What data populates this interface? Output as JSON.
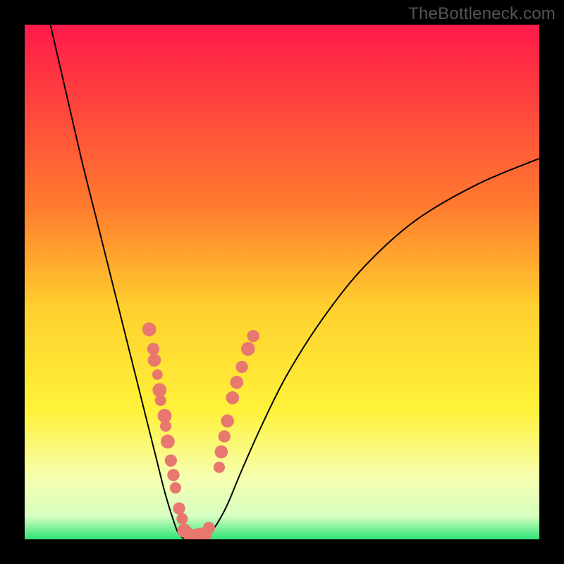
{
  "watermark": "TheBottleneck.com",
  "chart_data": {
    "type": "line",
    "title": "",
    "xlabel": "",
    "ylabel": "",
    "xlim": [
      0,
      100
    ],
    "ylim": [
      0,
      100
    ],
    "gradient_stops": [
      {
        "offset": 0.0,
        "color": "#ff1a4a"
      },
      {
        "offset": 0.35,
        "color": "#ff7a2e"
      },
      {
        "offset": 0.55,
        "color": "#ffd02e"
      },
      {
        "offset": 0.75,
        "color": "#fff23a"
      },
      {
        "offset": 0.88,
        "color": "#f6ffb0"
      },
      {
        "offset": 0.955,
        "color": "#d6ffc0"
      },
      {
        "offset": 1.0,
        "color": "#2ee37a"
      }
    ],
    "series": [
      {
        "name": "left-curve",
        "type": "curve",
        "x": [
          5,
          8,
          11,
          14,
          17,
          19,
          21,
          23,
          24.5,
          26,
          27,
          28,
          28.8,
          29.3,
          29.7,
          30.2,
          30.7,
          31.2
        ],
        "y": [
          100,
          87,
          74,
          62,
          50,
          42,
          34,
          26,
          20,
          14,
          10,
          6.5,
          4,
          2.5,
          1.5,
          0.8,
          0.3,
          0.1
        ]
      },
      {
        "name": "valley-floor",
        "type": "curve",
        "x": [
          31.2,
          32.0,
          33.0,
          34.0,
          35.0
        ],
        "y": [
          0.1,
          0.05,
          0.05,
          0.1,
          0.3
        ]
      },
      {
        "name": "right-curve",
        "type": "curve",
        "x": [
          35.0,
          36.0,
          37.5,
          39.5,
          42,
          46,
          51,
          58,
          66,
          76,
          88,
          100
        ],
        "y": [
          0.3,
          1.2,
          3.2,
          7,
          13,
          22,
          32,
          43,
          53,
          62,
          69,
          74
        ]
      }
    ],
    "scatter": {
      "name": "dots",
      "color": "#e8786f",
      "points": [
        {
          "x": 24.2,
          "y": 40.8,
          "r": 1.6
        },
        {
          "x": 25.0,
          "y": 37.0,
          "r": 1.4
        },
        {
          "x": 25.2,
          "y": 34.8,
          "r": 1.5
        },
        {
          "x": 25.8,
          "y": 32.0,
          "r": 1.2
        },
        {
          "x": 26.2,
          "y": 29.0,
          "r": 1.6
        },
        {
          "x": 26.4,
          "y": 27.0,
          "r": 1.3
        },
        {
          "x": 27.2,
          "y": 24.0,
          "r": 1.6
        },
        {
          "x": 27.4,
          "y": 22.0,
          "r": 1.3
        },
        {
          "x": 27.8,
          "y": 19.0,
          "r": 1.6
        },
        {
          "x": 28.4,
          "y": 15.3,
          "r": 1.4
        },
        {
          "x": 28.9,
          "y": 12.5,
          "r": 1.4
        },
        {
          "x": 29.3,
          "y": 10.0,
          "r": 1.3
        },
        {
          "x": 30.0,
          "y": 6.0,
          "r": 1.4
        },
        {
          "x": 30.6,
          "y": 4.0,
          "r": 1.3
        },
        {
          "x": 31.0,
          "y": 1.7,
          "r": 1.6
        },
        {
          "x": 32.0,
          "y": 0.9,
          "r": 1.5
        },
        {
          "x": 33.0,
          "y": 0.8,
          "r": 1.4
        },
        {
          "x": 34.0,
          "y": 0.8,
          "r": 1.7
        },
        {
          "x": 35.0,
          "y": 1.0,
          "r": 1.6
        },
        {
          "x": 35.8,
          "y": 2.2,
          "r": 1.4
        },
        {
          "x": 37.8,
          "y": 14.0,
          "r": 1.3
        },
        {
          "x": 38.2,
          "y": 17.0,
          "r": 1.5
        },
        {
          "x": 38.8,
          "y": 20.0,
          "r": 1.4
        },
        {
          "x": 39.4,
          "y": 23.0,
          "r": 1.5
        },
        {
          "x": 40.4,
          "y": 27.5,
          "r": 1.5
        },
        {
          "x": 41.2,
          "y": 30.5,
          "r": 1.5
        },
        {
          "x": 42.2,
          "y": 33.5,
          "r": 1.4
        },
        {
          "x": 43.4,
          "y": 37.0,
          "r": 1.6
        },
        {
          "x": 44.4,
          "y": 39.5,
          "r": 1.4
        }
      ]
    }
  }
}
